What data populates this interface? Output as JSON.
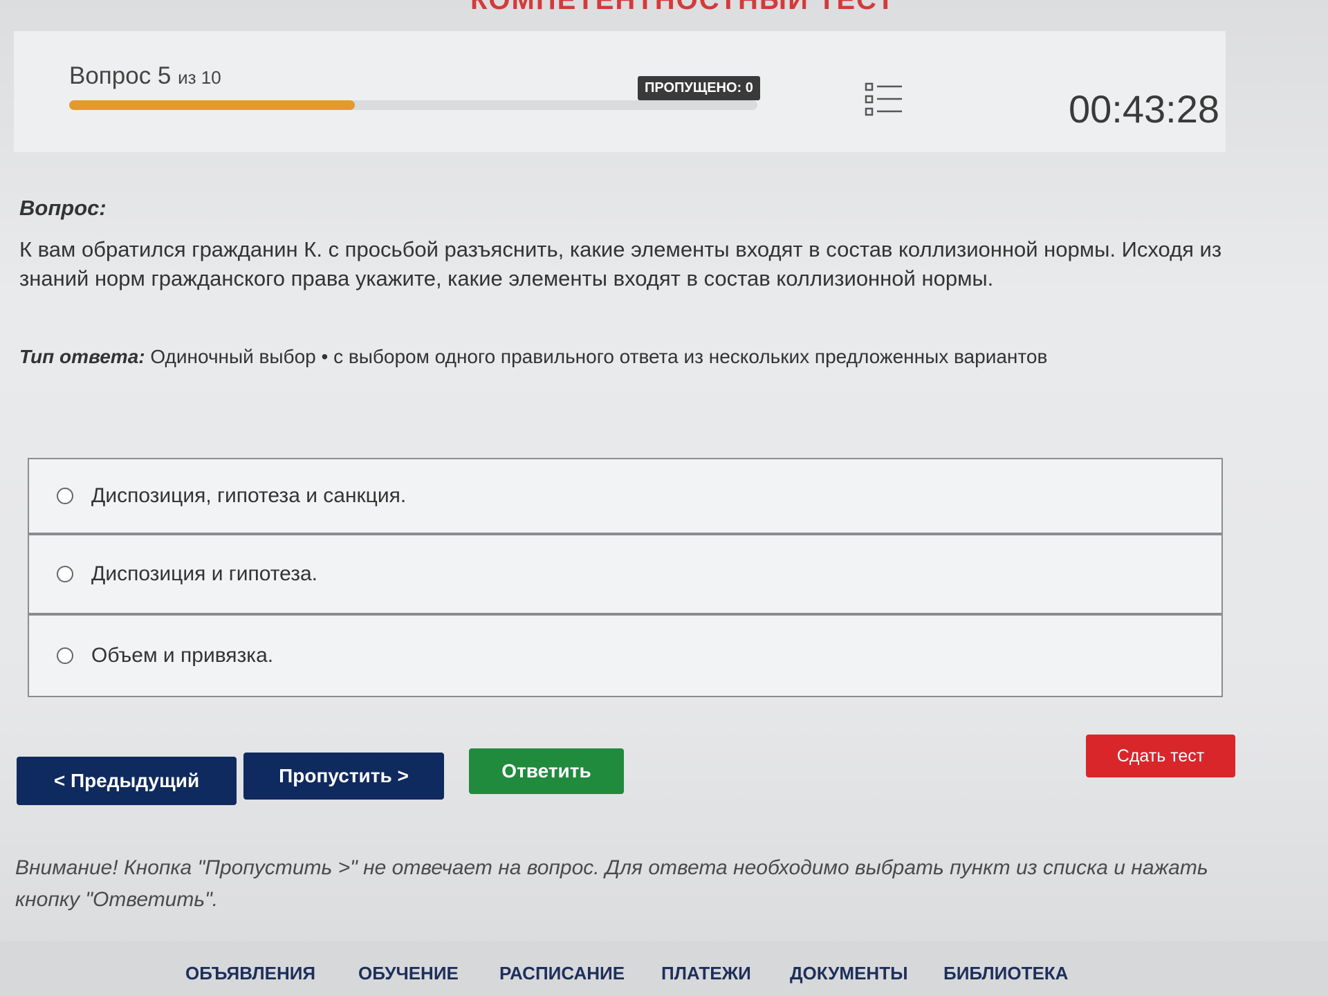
{
  "header": {
    "page_title": "КОМПЕТЕНТНОСТНЫЙ ТЕСТ",
    "question_word": "Вопрос 5",
    "question_total": "из 10",
    "progress_fraction": 0.415,
    "skipped_label": "ПРОПУЩЕНО: 0",
    "timer": "00:43:28"
  },
  "question": {
    "label": "Вопрос:",
    "text": "К вам обратился гражданин К. с просьбой разъяснить, какие элементы входят в состав коллизионной нормы. Исходя из знаний норм гражданского права укажите, какие элементы входят в состав коллизионной нормы.",
    "answer_type_label": "Тип ответа:",
    "answer_type_value": "Одиночный выбор • с выбором одного правильного ответа из нескольких предложенных вариантов"
  },
  "options": [
    {
      "label": "Диспозиция, гипотеза и санкция."
    },
    {
      "label": "Диспозиция и гипотеза."
    },
    {
      "label": "Объем и привязка."
    }
  ],
  "buttons": {
    "prev": "< Предыдущий",
    "skip": "Пропустить >",
    "answer": "Ответить",
    "submit": "Сдать тест"
  },
  "warning": "Внимание! Кнопка \"Пропустить >\" не отвечает на вопрос. Для ответа необходимо выбрать пункт из списка и нажать кнопку \"Ответить\".",
  "footer_nav": [
    "ОБЪЯВЛЕНИЯ",
    "ОБУЧЕНИЕ",
    "РАСПИСАНИЕ",
    "ПЛАТЕЖИ",
    "ДОКУМЕНТЫ",
    "БИБЛИОТЕКА"
  ]
}
